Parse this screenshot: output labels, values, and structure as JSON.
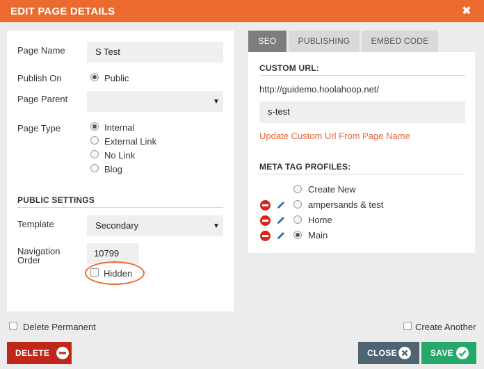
{
  "dialog": {
    "title": "EDIT PAGE DETAILS",
    "close_glyph": "✖"
  },
  "form": {
    "page_name_label": "Page Name",
    "page_name_value": "S Test",
    "publish_on_label": "Publish On",
    "publish_on_options": [
      {
        "label": "Public",
        "checked": true
      }
    ],
    "page_parent_label": "Page Parent",
    "page_parent_value": "",
    "page_type_label": "Page Type",
    "page_type_options": [
      {
        "label": "Internal",
        "checked": true
      },
      {
        "label": "External Link",
        "checked": false
      },
      {
        "label": "No Link",
        "checked": false
      },
      {
        "label": "Blog",
        "checked": false
      }
    ]
  },
  "public_settings": {
    "heading": "PUBLIC SETTINGS",
    "template_label": "Template",
    "template_value": "Secondary",
    "nav_order_label_1": "Navigation",
    "nav_order_label_2": "Order",
    "nav_order_value": "10799",
    "hidden_label": "Hidden",
    "hidden_checked": false
  },
  "tabs": [
    {
      "label": "SEO",
      "active": true
    },
    {
      "label": "PUBLISHING",
      "active": false
    },
    {
      "label": "EMBED CODE",
      "active": false
    }
  ],
  "seo": {
    "custom_url_heading": "CUSTOM URL:",
    "base_url": "http://guidemo.hoolahoop.net/",
    "slug_value": "s-test",
    "update_link": "Update Custom Url From Page Name",
    "meta_heading": "META TAG PROFILES:",
    "profiles": [
      {
        "label": "Create New",
        "checked": false,
        "editable": false
      },
      {
        "label": "ampersands & test",
        "checked": false,
        "editable": true
      },
      {
        "label": "Home",
        "checked": false,
        "editable": true
      },
      {
        "label": "Main",
        "checked": true,
        "editable": true
      }
    ]
  },
  "footer": {
    "delete_permanent_label": "Delete Permanent",
    "create_another_label": "Create Another",
    "delete_button": "DELETE",
    "close_button": "CLOSE",
    "save_button": "SAVE"
  },
  "colors": {
    "accent": "#ec6a2d",
    "delete": "#c0271b",
    "close": "#4f6472",
    "save": "#26a86a",
    "link": "#e8643a",
    "tab_active": "#7d7d7d",
    "tab_inactive": "#d9d9d9"
  }
}
